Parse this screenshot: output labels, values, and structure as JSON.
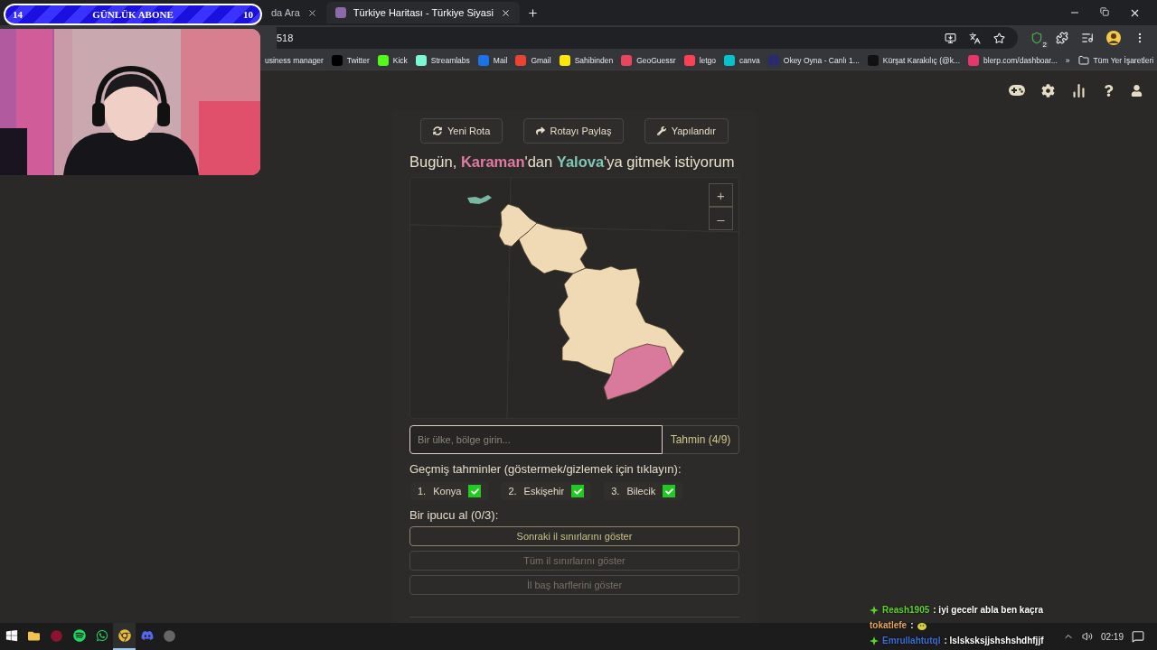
{
  "overlay": {
    "subscriber_goal": {
      "current": "14",
      "label": "GÜNLÜK ABONE",
      "target": "10"
    }
  },
  "browser": {
    "tabs": [
      {
        "title": "da Ara",
        "selected": false
      },
      {
        "title": "Türkiye Haritası - Türkiye Siyasi",
        "selected": true
      }
    ],
    "address": "518",
    "bookmarks": [
      {
        "label": "usiness manager"
      },
      {
        "label": "Twitter"
      },
      {
        "label": "Kick"
      },
      {
        "label": "Streamlabs"
      },
      {
        "label": "Mail"
      },
      {
        "label": "Gmail"
      },
      {
        "label": "Sahibinden"
      },
      {
        "label": "GeoGuessr"
      },
      {
        "label": "letgo"
      },
      {
        "label": "canva"
      },
      {
        "label": "Okey Oyna - Canlı 1..."
      },
      {
        "label": "Kürşat Karakılıç (@k..."
      },
      {
        "label": "blerp.com/dashboar..."
      }
    ],
    "more_bookmarks": "»",
    "all_bookmarks": "Tüm Yer İşaretleri",
    "extension_badge": "2"
  },
  "page": {
    "toolbar": [
      {
        "label": "Yeni Rota",
        "kind": "refresh"
      },
      {
        "label": "Rotayı Paylaş",
        "kind": "share"
      },
      {
        "label": "Yapılandır",
        "kind": "wrench"
      }
    ],
    "heading": {
      "start": "Bugün, ",
      "origin": "Karaman",
      "middle": "'dan ",
      "destination": "Yalova",
      "end": "'ya gitmek istiyorum"
    },
    "zoom": {
      "in": "+",
      "out": "–"
    },
    "guess": {
      "placeholder": "Bir ülke, bölge girin...",
      "button": "Tahmin (4/9)"
    },
    "history_label": "Geçmiş tahminler (göstermek/gizlemek için tıklayın):",
    "guesses": [
      {
        "number": "1.",
        "name": "Konya",
        "correct": true
      },
      {
        "number": "2.",
        "name": "Eskişehir",
        "correct": true
      },
      {
        "number": "3.",
        "name": "Bilecik",
        "correct": true
      }
    ],
    "hint_label": "Bir ipucu al (0/3):",
    "hints": [
      {
        "label": "Sonraki il sınırlarını göster",
        "disabled": false
      },
      {
        "label": "Tüm il sınırlarını göster",
        "disabled": true
      },
      {
        "label": "İl baş harflerini göster",
        "disabled": true
      }
    ]
  },
  "chat": [
    {
      "user": "Reash1905",
      "color": "#5ed32d",
      "badge": true,
      "kind": "text",
      "message": ": iyi gecelr abla ben kaçra"
    },
    {
      "user": "tokatlefe",
      "color": "#e3a75a",
      "badge": false,
      "kind": "emote",
      "message": ":"
    },
    {
      "user": "Emrullahtutql",
      "color": "#3d6fd8",
      "badge": true,
      "kind": "text",
      "message": ": lslsksksjjshshshdhfjjf"
    }
  ],
  "taskbar": {
    "time": "02:19"
  }
}
